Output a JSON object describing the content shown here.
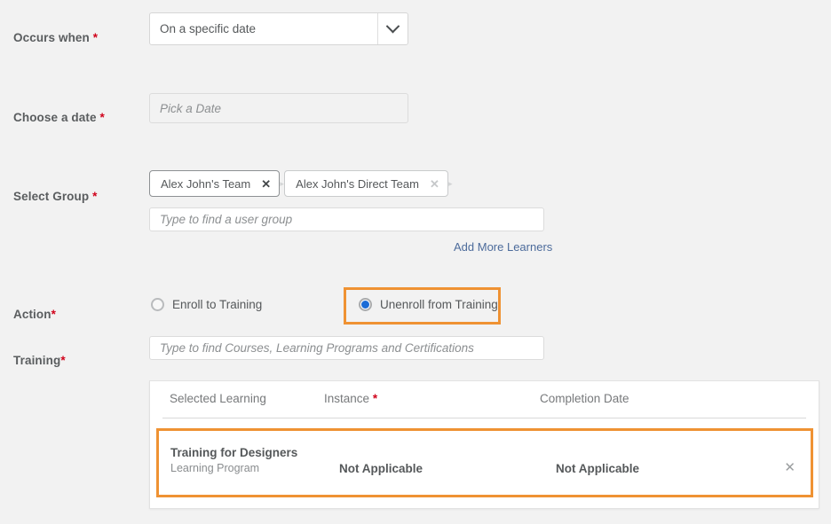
{
  "fields": {
    "occurs_when": {
      "label": "Occurs when",
      "required_marker": "*",
      "selected_option": "On a specific date",
      "arrow_icon": "chevron-down-icon"
    },
    "choose_date": {
      "label": "Choose a date",
      "required_marker": "*",
      "placeholder": "Pick a Date",
      "value": ""
    },
    "select_group": {
      "label": "Select Group",
      "required_marker": "*",
      "chips": [
        {
          "text": "Alex John's Team",
          "remove_icon": "close-icon",
          "active": true
        },
        {
          "text": "Alex John's Direct Team",
          "remove_icon": "close-icon",
          "active": false
        }
      ],
      "placeholder": "Type to find a user group",
      "value": "",
      "add_more_link": "Add More Learners"
    },
    "action": {
      "label": "Action",
      "required_marker": "*",
      "options": [
        {
          "label": "Enroll to Training",
          "selected": false
        },
        {
          "label": "Unenroll from Training",
          "selected": true
        }
      ],
      "highlight_color": "#ef9233"
    },
    "training": {
      "label": "Training",
      "required_marker": "*",
      "placeholder": "Type to find Courses, Learning Programs and Certifications",
      "value": ""
    }
  },
  "table": {
    "headers": {
      "selected_learning": "Selected Learning",
      "instance": "Instance",
      "instance_required_marker": "*",
      "completion_date": "Completion Date"
    },
    "rows": [
      {
        "title": "Training for Designers",
        "subtitle": "Learning Program",
        "instance": "Not Applicable",
        "completion_date": "Not Applicable",
        "remove_icon": "close-icon",
        "highlighted": true
      }
    ],
    "highlight_color": "#ef9233"
  },
  "colors": {
    "page_background": "#f2f2f2",
    "accent_highlight": "#ef9233",
    "link": "#4c6b9b",
    "required_asterisk": "#d0021b",
    "radio_selected": "#1a6bd6",
    "text": "#55585a"
  }
}
